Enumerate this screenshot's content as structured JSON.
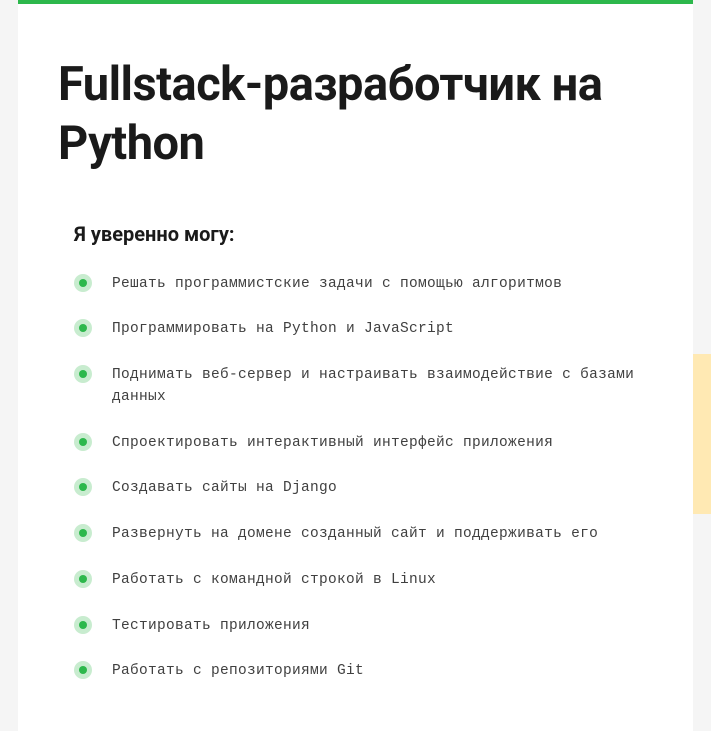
{
  "title": "Fullstack-разработчик на Python",
  "subtitle": "Я уверенно могу:",
  "skills": [
    "Решать программистские задачи с помощью алгоритмов",
    "Программировать на Python и JavaScript",
    "Поднимать веб-сервер и настраивать взаимодействие с базами данных",
    "Спроектировать интерактивный интерфейс приложения",
    "Создавать сайты на Django",
    "Развернуть на домене созданный сайт и поддерживать его",
    "Работать с командной строкой в Linux",
    "Тестировать приложения",
    "Работать с репозиториями Git"
  ]
}
